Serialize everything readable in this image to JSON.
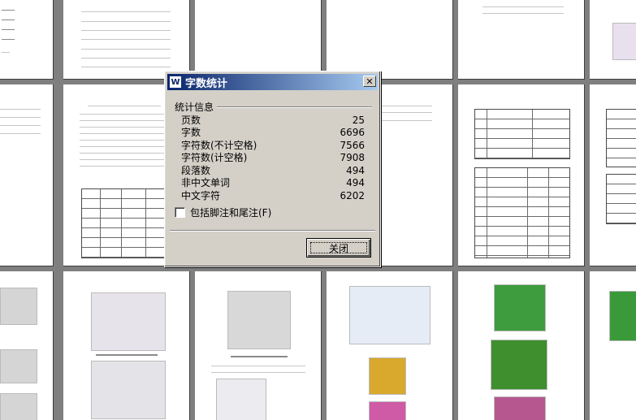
{
  "dialog": {
    "title": "字数统计",
    "close_glyph": "✕",
    "icon_glyph": "W",
    "group_label": "统计信息",
    "stats": [
      {
        "label": "页数",
        "value": "25"
      },
      {
        "label": "字数",
        "value": "6696"
      },
      {
        "label": "字符数(不计空格)",
        "value": "7566"
      },
      {
        "label": "字符数(计空格)",
        "value": "7908"
      },
      {
        "label": "段落数",
        "value": "494"
      },
      {
        "label": "非中文单词",
        "value": "494"
      },
      {
        "label": "中文字符",
        "value": "6202"
      }
    ],
    "footnote_checkbox_label": "包括脚注和尾注(F)",
    "footnote_checked": false,
    "close_button_label": "关闭"
  },
  "icons": {
    "title_icon": "word-app-icon",
    "close_icon": "close-icon"
  },
  "colors": {
    "titlebar_start": "#0a246a",
    "titlebar_end": "#a6caf0",
    "dialog_face": "#d4d0c8",
    "workspace": "#7f7f7f"
  }
}
